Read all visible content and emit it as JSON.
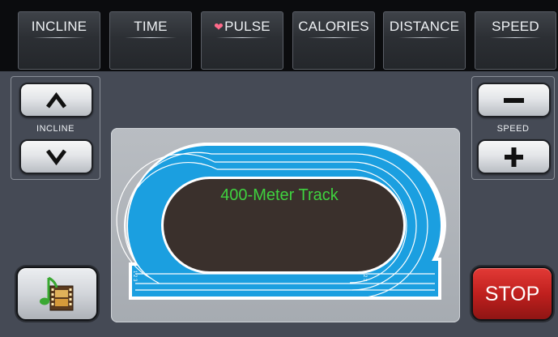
{
  "metrics": [
    {
      "label": "INCLINE"
    },
    {
      "label": "TIME"
    },
    {
      "label": "PULSE",
      "icon": "heart-icon"
    },
    {
      "label": "CALORIES"
    },
    {
      "label": "DISTANCE"
    },
    {
      "label": "SPEED"
    }
  ],
  "incline_panel": {
    "label": "INCLINE",
    "up_icon": "chevron-up-icon",
    "down_icon": "chevron-down-icon"
  },
  "speed_panel": {
    "label": "SPEED",
    "minus_icon": "minus-icon",
    "plus_icon": "plus-icon"
  },
  "track": {
    "title": "400-Meter Track",
    "lane_numbers_left": "1 2 3",
    "lane_numbers_right": "1 2 3",
    "colors": {
      "track": "#1b9fe0",
      "infield": "#3a302c",
      "lane_line": "#ffffff",
      "title": "#3fd23f"
    }
  },
  "media_button": {
    "icon": "music-film-icon"
  },
  "stop_button": {
    "label": "STOP",
    "color": "#c0201e"
  }
}
